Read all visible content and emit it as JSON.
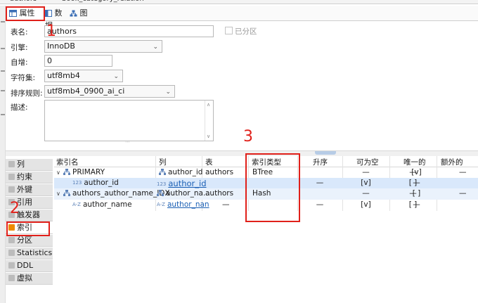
{
  "editor_tabs": [
    {
      "label": "authors"
    },
    {
      "label": "book_category_relation"
    }
  ],
  "sub_tabs": [
    {
      "label": "属性",
      "icon": "table-properties-icon",
      "active": true
    },
    {
      "label": "数据",
      "icon": "data-grid-icon",
      "active": false
    },
    {
      "label": "图",
      "icon": "er-diagram-icon",
      "active": false
    }
  ],
  "form": {
    "table_name_label": "表名:",
    "table_name_value": "authors",
    "partitioned_label": "已分区",
    "engine_label": "引擎:",
    "engine_value": "InnoDB",
    "auto_increment_label": "自增:",
    "auto_increment_value": "0",
    "charset_label": "字符集:",
    "charset_value": "utf8mb4",
    "collation_label": "排序规则:",
    "collation_value": "utf8mb4_0900_ai_ci",
    "description_label": "描述:",
    "description_value": ""
  },
  "side_nav": [
    {
      "label": "列",
      "active": false
    },
    {
      "label": "约束",
      "active": false
    },
    {
      "label": "外键",
      "active": false
    },
    {
      "label": "引用",
      "active": false
    },
    {
      "label": "触发器",
      "active": false
    },
    {
      "label": "索引",
      "active": true
    },
    {
      "label": "分区",
      "active": false
    },
    {
      "label": "Statistics",
      "active": false
    },
    {
      "label": "DDL",
      "active": false
    },
    {
      "label": "虚拟",
      "active": false
    }
  ],
  "index_table": {
    "headers": {
      "name": "索引名",
      "column": "列",
      "table": "表",
      "index_type": "索引类型",
      "ascending": "升序",
      "nullable": "可为空",
      "unique": "唯一的",
      "extra": "额外的"
    },
    "rows": [
      {
        "kind": "index",
        "name": "PRIMARY",
        "column": "author_id",
        "table": "authors",
        "index_type": "BTree",
        "ascending": "—",
        "nullable": "—",
        "unique": "[v]",
        "extra": "—"
      },
      {
        "kind": "column",
        "name": "author_id",
        "column": "author_id",
        "table": "",
        "index_type": "—",
        "ascending": "[v]",
        "nullable": "[ ]",
        "unique": "—",
        "extra": ""
      },
      {
        "kind": "index",
        "name": "authors_author_name_IDX",
        "column": "author_na...",
        "table": "authors",
        "index_type": "Hash",
        "ascending": "—",
        "nullable": "—",
        "unique": "[ ]",
        "extra": "—"
      },
      {
        "kind": "column",
        "name": "author_name",
        "column": "author_nan",
        "table": "—",
        "index_type": "—",
        "ascending": "[v]",
        "nullable": "[ ]",
        "unique": "—",
        "extra": ""
      }
    ]
  },
  "annotations": {
    "one": "1",
    "two": "2",
    "three": "3",
    "color": "#e0201a"
  },
  "colors": {
    "selected_row": "#d9e8fb",
    "selected_row_light": "#eaf2fc",
    "active_nav_icon": "#ee8a00",
    "link": "#1a5fb4"
  }
}
